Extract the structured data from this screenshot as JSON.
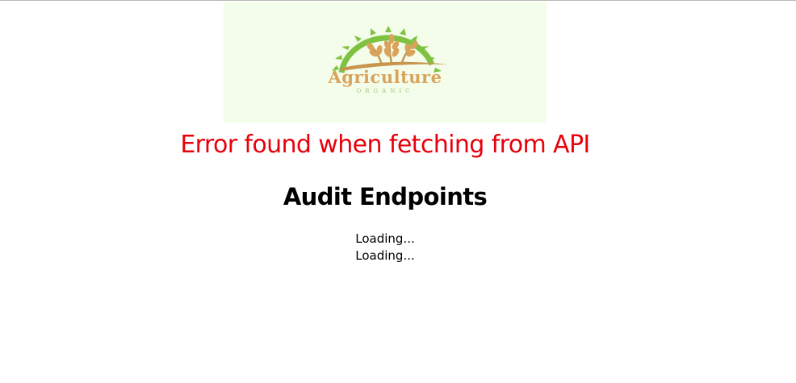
{
  "logo": {
    "title": "Agriculture",
    "subtitle": "ORGANIC",
    "background": "#f4fdea",
    "sun_color": "#7fc242",
    "wheat_color": "#d9a35c"
  },
  "error": {
    "message": "Error found when fetching from API",
    "color": "#e8000b"
  },
  "title": "Audit Endpoints",
  "loading": [
    "Loading...",
    "Loading..."
  ]
}
